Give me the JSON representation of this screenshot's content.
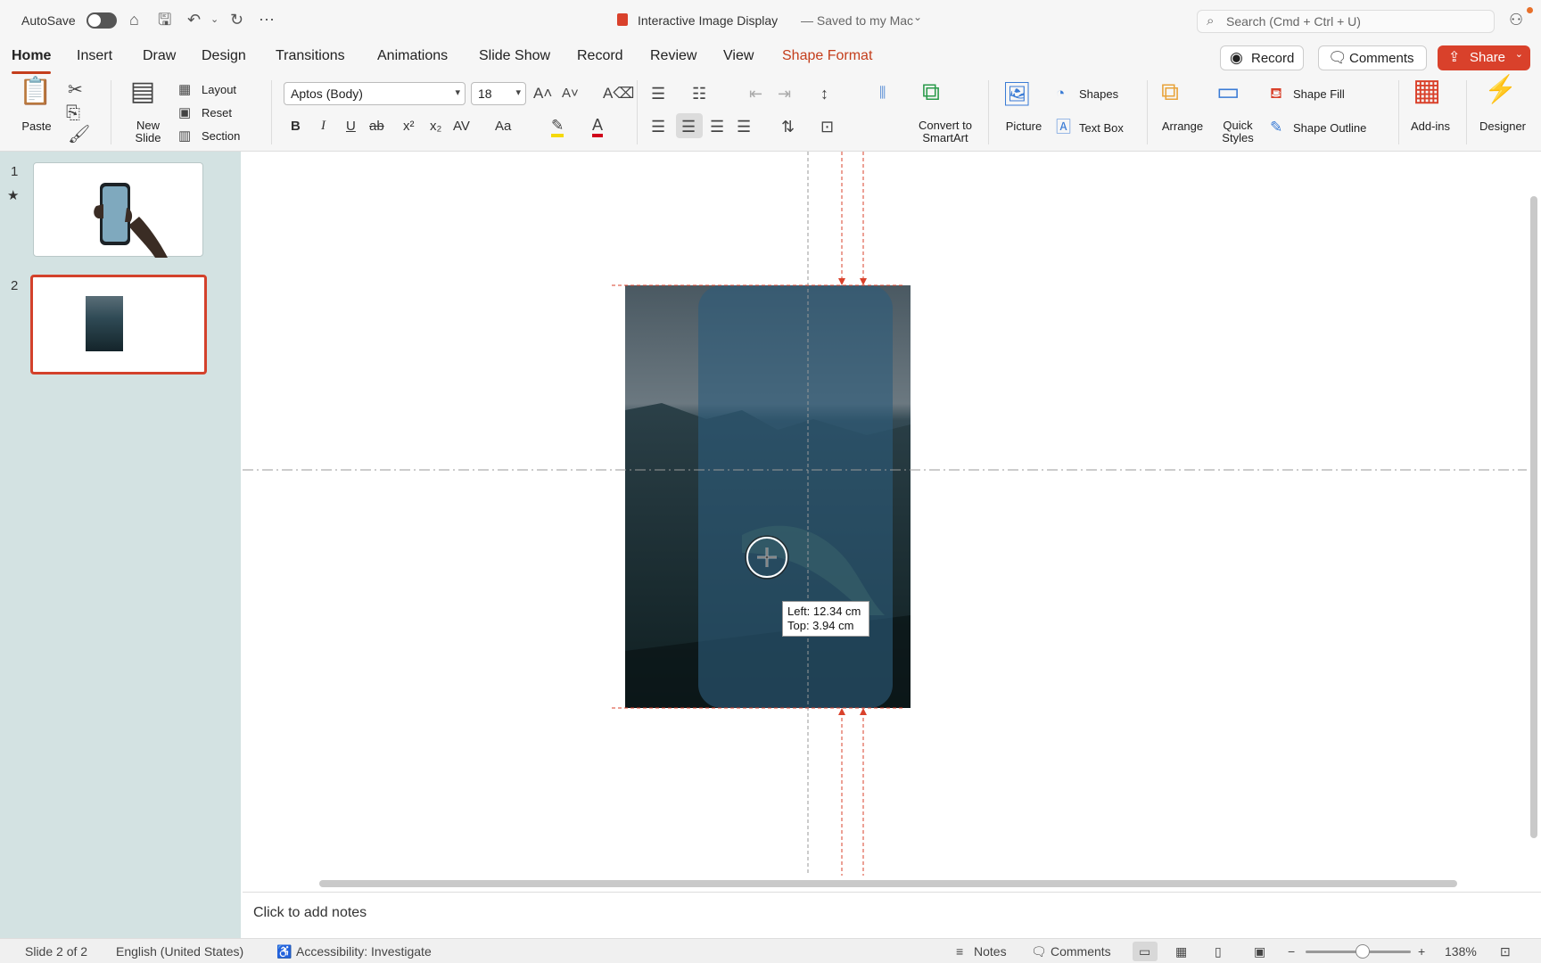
{
  "titlebar": {
    "autosave_label": "AutoSave",
    "doc_title": "Interactive Image Display",
    "saved_status": "— Saved to my Mac",
    "search_placeholder": "Search (Cmd + Ctrl + U)"
  },
  "tabs": [
    {
      "label": "Home",
      "active": true
    },
    {
      "label": "Insert"
    },
    {
      "label": "Draw"
    },
    {
      "label": "Design"
    },
    {
      "label": "Transitions"
    },
    {
      "label": "Animations"
    },
    {
      "label": "Slide Show"
    },
    {
      "label": "Record"
    },
    {
      "label": "Review"
    },
    {
      "label": "View"
    },
    {
      "label": "Shape Format",
      "accent": true
    }
  ],
  "header_buttons": {
    "record": "Record",
    "comments": "Comments",
    "share": "Share"
  },
  "ribbon": {
    "paste": "Paste",
    "new_slide_1": "New",
    "new_slide_2": "Slide",
    "layout": "Layout",
    "reset": "Reset",
    "section": "Section",
    "font_name": "Aptos (Body)",
    "font_size": "18",
    "bold": "B",
    "italic": "I",
    "underline": "U",
    "strike": "ab",
    "superscript": "x²",
    "subscript": "x₂",
    "char_spacing": "AV",
    "change_case": "Aa",
    "convert_1": "Convert to",
    "convert_2": "SmartArt",
    "picture": "Picture",
    "shapes": "Shapes",
    "text_box": "Text Box",
    "arrange": "Arrange",
    "quick_styles_1": "Quick",
    "quick_styles_2": "Styles",
    "shape_fill": "Shape Fill",
    "shape_outline": "Shape Outline",
    "addins": "Add-ins",
    "designer": "Designer"
  },
  "slides": [
    {
      "number": "1",
      "marker": "★"
    },
    {
      "number": "2"
    }
  ],
  "tooltip": {
    "left": "Left: 12.34 cm",
    "top": "Top: 3.94 cm"
  },
  "notes_placeholder": "Click to add notes",
  "status": {
    "slide_count": "Slide 2 of 2",
    "language": "English (United States)",
    "accessibility": "Accessibility: Investigate",
    "notes": "Notes",
    "comments": "Comments",
    "zoom": "138%"
  },
  "colors": {
    "accent": "#c43e1c",
    "share": "#d9412b",
    "panel": "#d3e2e2"
  }
}
